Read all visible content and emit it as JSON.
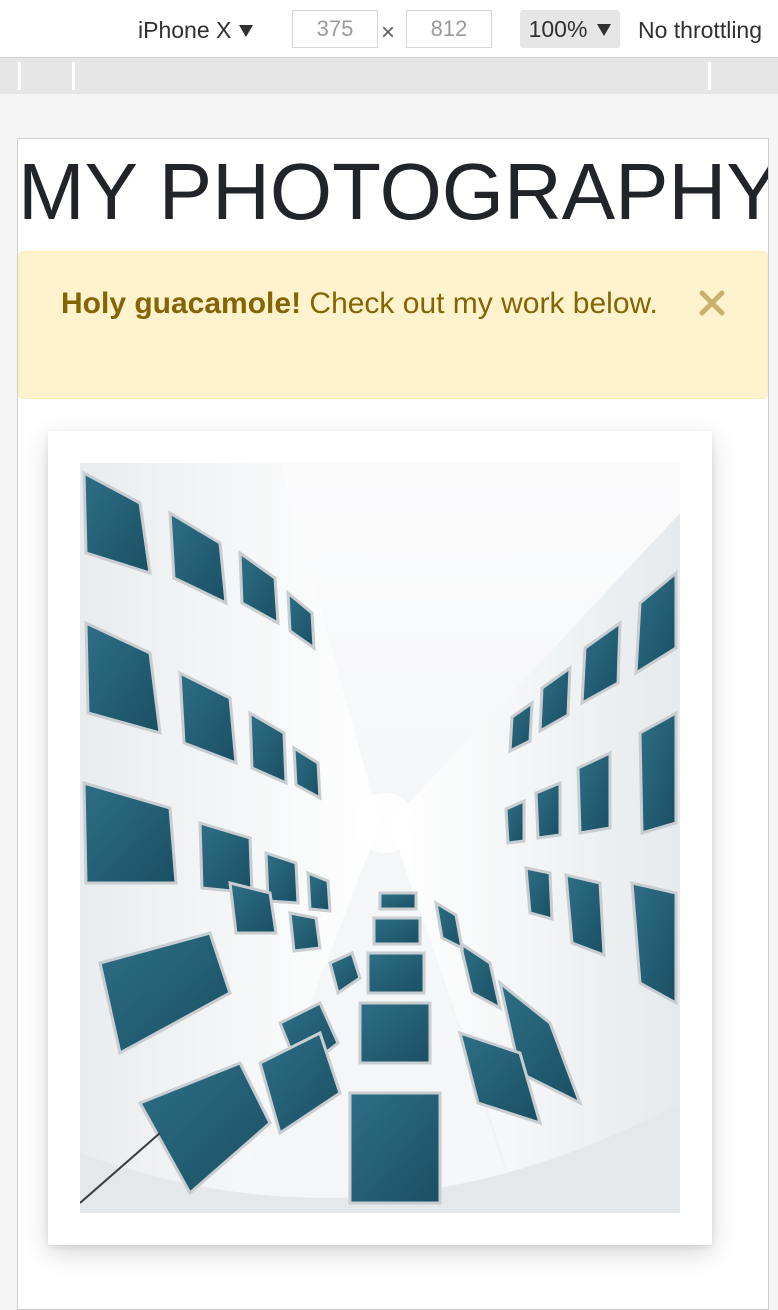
{
  "devtools": {
    "device": "iPhone X",
    "width": "375",
    "times": "×",
    "height": "812",
    "zoom": "100%",
    "throttling": "No throttling"
  },
  "page": {
    "title": "MY PHOTOGRAPHY",
    "alert": {
      "strong": "Holy guacamole!",
      "text": " Check out my work below.",
      "close_icon": "close-icon",
      "bg_color": "#fff3cd",
      "text_color": "#856404"
    },
    "photo": {
      "subject": "architecture-photo"
    }
  }
}
